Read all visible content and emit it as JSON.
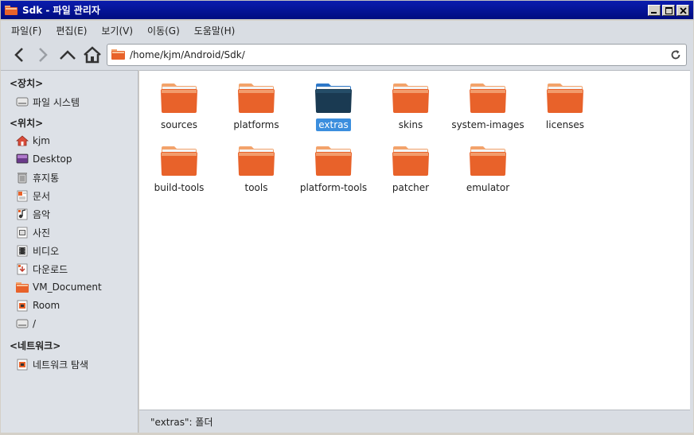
{
  "window": {
    "title": "Sdk - 파일 관리자",
    "minimize": "_",
    "maximize": "□",
    "close": "×"
  },
  "menu": [
    "파일(F)",
    "편집(E)",
    "보기(V)",
    "이동(G)",
    "도움말(H)"
  ],
  "address": {
    "path": "/home/kjm/Android/Sdk/"
  },
  "sidebar": {
    "sections": [
      {
        "header": "<장치>",
        "items": [
          {
            "label": "파일 시스템",
            "icon": "drive-icon"
          }
        ]
      },
      {
        "header": "<위치>",
        "items": [
          {
            "label": "kjm",
            "icon": "home-icon"
          },
          {
            "label": "Desktop",
            "icon": "desktop-icon"
          },
          {
            "label": "휴지통",
            "icon": "trash-icon"
          },
          {
            "label": "문서",
            "icon": "documents-icon"
          },
          {
            "label": "음악",
            "icon": "music-icon"
          },
          {
            "label": "사진",
            "icon": "pictures-icon"
          },
          {
            "label": "비디오",
            "icon": "video-icon"
          },
          {
            "label": "다운로드",
            "icon": "download-icon"
          },
          {
            "label": "VM_Document",
            "icon": "folder-icon"
          },
          {
            "label": "Room",
            "icon": "folder-icon"
          },
          {
            "label": "/",
            "icon": "drive-icon"
          }
        ]
      },
      {
        "header": "<네트워크>",
        "items": [
          {
            "label": "네트워크 탐색",
            "icon": "network-icon"
          }
        ]
      }
    ]
  },
  "folders": [
    {
      "name": "sources",
      "selected": false
    },
    {
      "name": "platforms",
      "selected": false
    },
    {
      "name": "extras",
      "selected": true
    },
    {
      "name": "skins",
      "selected": false
    },
    {
      "name": "system-images",
      "selected": false
    },
    {
      "name": "licenses",
      "selected": false
    },
    {
      "name": "build-tools",
      "selected": false
    },
    {
      "name": "tools",
      "selected": false
    },
    {
      "name": "platform-tools",
      "selected": false
    },
    {
      "name": "patcher",
      "selected": false
    },
    {
      "name": "emulator",
      "selected": false
    }
  ],
  "status": {
    "text": "\"extras\": 폴더"
  },
  "colors": {
    "folder_orange": "#e8622a",
    "folder_selected": "#1a3a52",
    "selection": "#3b8ede",
    "titlebar": "#0a1cae"
  }
}
